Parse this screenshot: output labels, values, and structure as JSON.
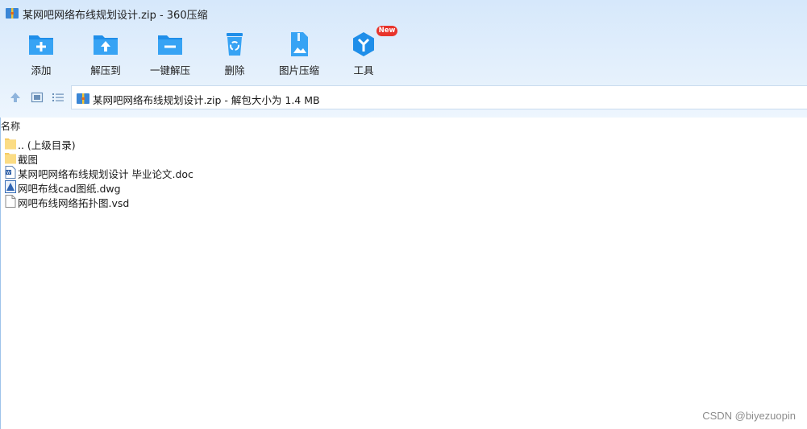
{
  "window": {
    "title": "某网吧网络布线规划设计.zip - 360压缩"
  },
  "toolbar": [
    {
      "label": "添加",
      "icon": "add-folder-icon"
    },
    {
      "label": "解压到",
      "icon": "extract-to-icon"
    },
    {
      "label": "一键解压",
      "icon": "one-click-extract-icon"
    },
    {
      "label": "删除",
      "icon": "recycle-bin-icon"
    },
    {
      "label": "图片压缩",
      "icon": "image-compress-icon"
    },
    {
      "label": "工具",
      "icon": "tools-icon",
      "badge": "New"
    }
  ],
  "address": {
    "path": "某网吧网络布线规划设计.zip - 解包大小为 1.4 MB"
  },
  "list": {
    "column_name": "名称",
    "items": [
      {
        "name": ".. (上级目录)",
        "icon": "folder-icon"
      },
      {
        "name": "截图",
        "icon": "folder-icon"
      },
      {
        "name": "某网吧网络布线规划设计 毕业论文.doc",
        "icon": "word-doc-icon"
      },
      {
        "name": "网吧布线cad图纸.dwg",
        "icon": "dwg-file-icon"
      },
      {
        "name": "网吧布线网络拓扑图.vsd",
        "icon": "blank-file-icon"
      }
    ]
  },
  "watermark": "CSDN @biyezuopin",
  "colors": {
    "accent": "#1e90e8",
    "header_bg": "#dcebfb"
  }
}
